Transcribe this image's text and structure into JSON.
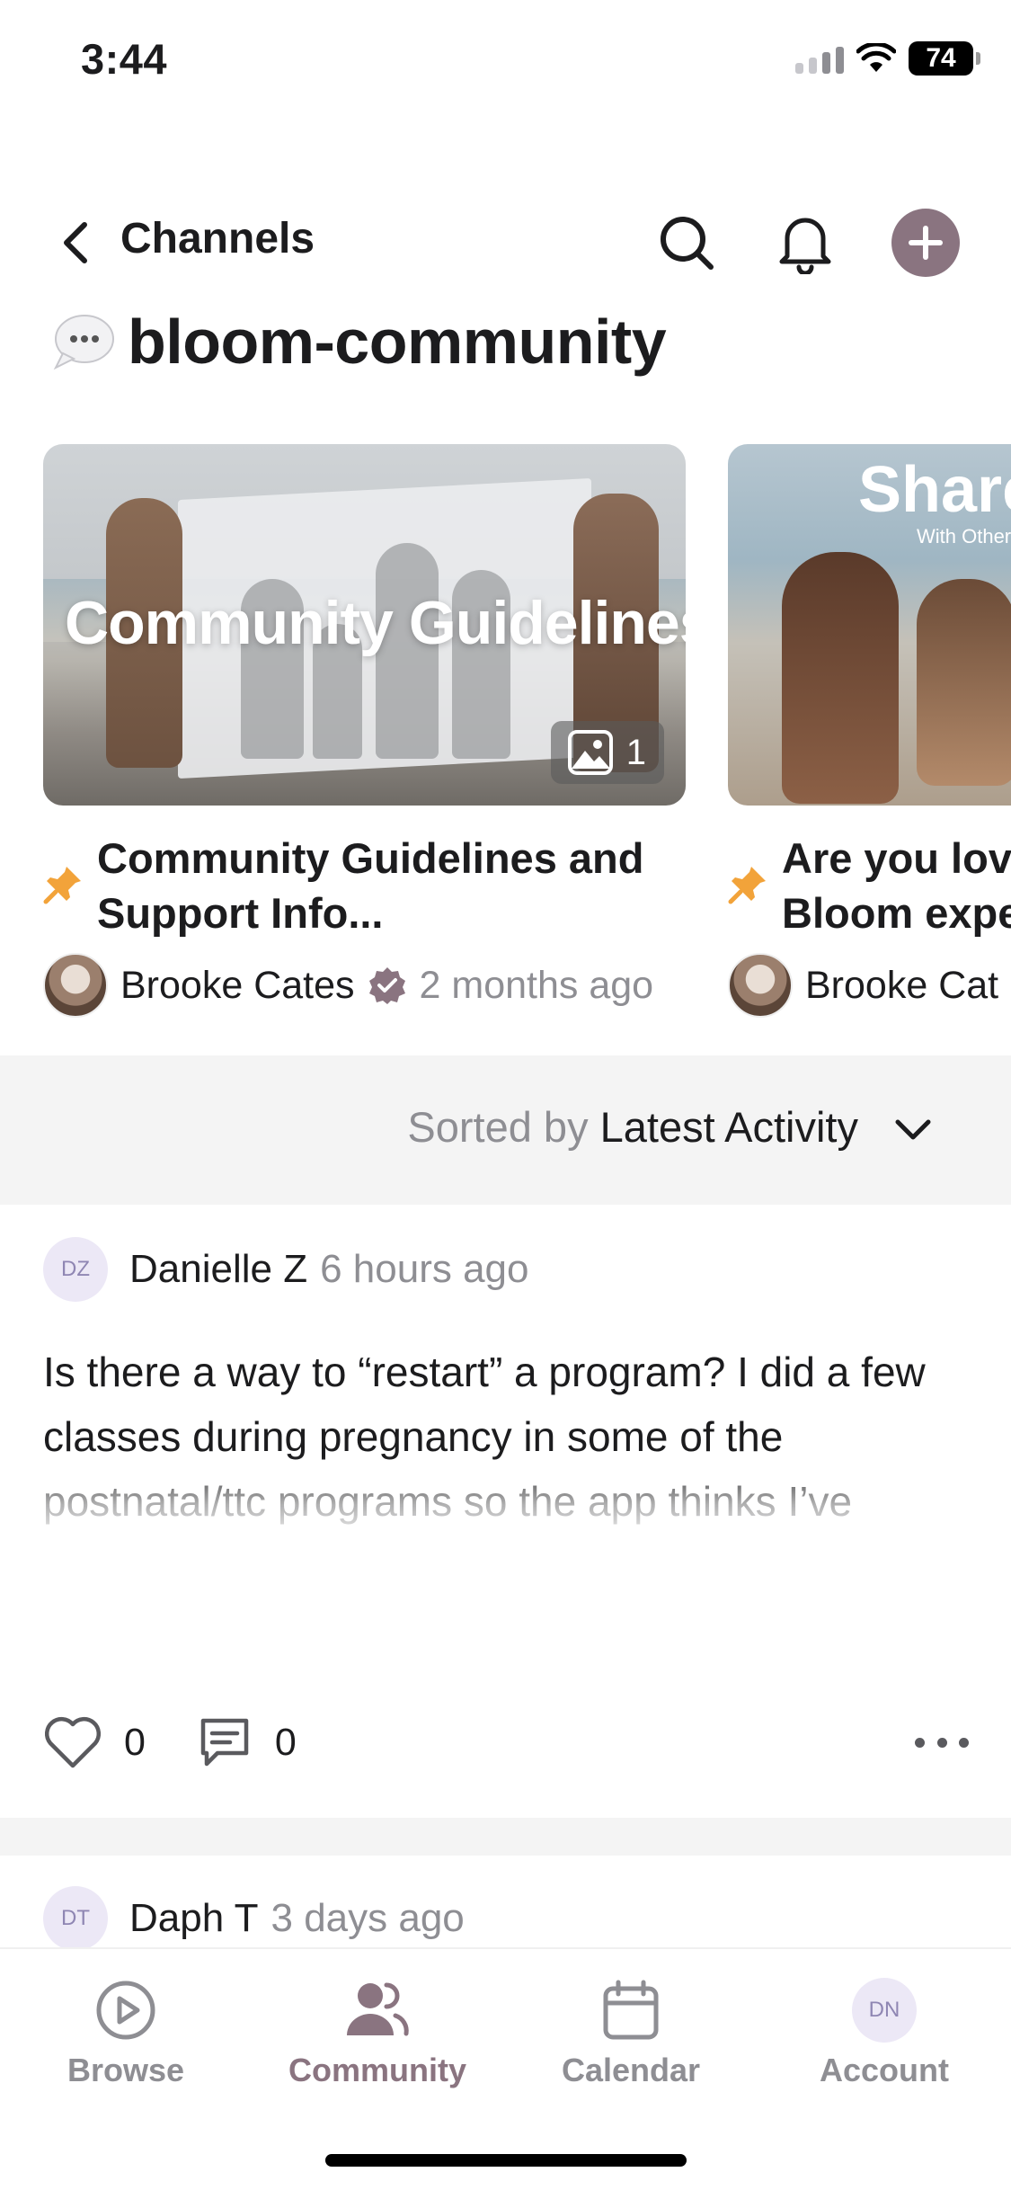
{
  "status_bar": {
    "time": "3:44",
    "battery": "74"
  },
  "header": {
    "back_label": "Channels"
  },
  "channel": {
    "name": "bloom-community"
  },
  "pinned": [
    {
      "image_text": "Community Guidelines",
      "image_count": "1",
      "title_line1": "Community Guidelines and",
      "title_line2": "Support Info...",
      "author": "Brooke Cates",
      "time": "2 months ago"
    },
    {
      "image_text": "Share",
      "image_subtext": "With Other",
      "title_line1": "Are you lov",
      "title_line2": "Bloom expe",
      "author": "Brooke Cat"
    }
  ],
  "sort": {
    "prefix": "Sorted by",
    "value": "Latest Activity"
  },
  "posts": [
    {
      "initials": "DZ",
      "author": "Danielle Z",
      "time": "6 hours ago",
      "body": "Is there a way to “restart” a program? I did a few classes during pregnancy in some of the postnatal/ttc programs so the app thinks I’ve completed that day(s) and jumps to the next one",
      "likes": "0",
      "comments": "0"
    },
    {
      "initials": "DT",
      "author": "Daph T",
      "time": "3 days ago"
    }
  ],
  "tabs": [
    {
      "label": "Browse",
      "icon": "play-circle-icon"
    },
    {
      "label": "Community",
      "icon": "people-icon",
      "active": true
    },
    {
      "label": "Calendar",
      "icon": "calendar-icon"
    },
    {
      "label": "Account",
      "icon": "avatar",
      "initials": "DN"
    }
  ],
  "colors": {
    "accent": "#8a7480",
    "pin": "#f2a33a",
    "muted": "#8e8e93",
    "sort_bg": "#f4f4f4",
    "avatar_bg": "#ece8f6"
  }
}
